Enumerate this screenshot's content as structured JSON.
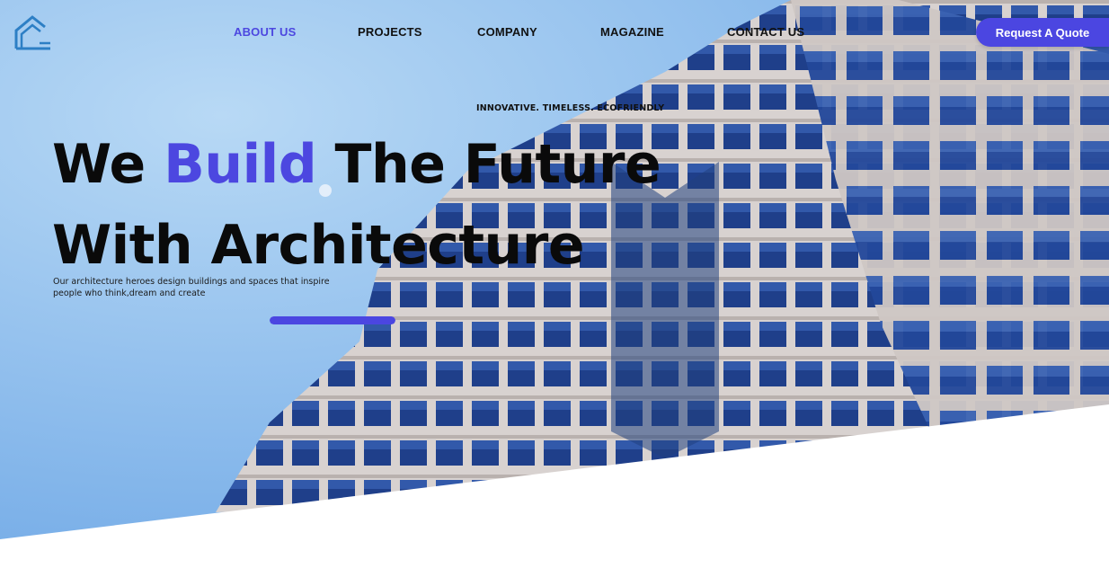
{
  "brand": {
    "logo_icon": "house-outline-icon",
    "accent_color": "#4c47e0"
  },
  "nav": {
    "items": [
      {
        "label": "ABOUT US",
        "active": true
      },
      {
        "label": "PROJECTS",
        "active": false
      },
      {
        "label": "COMPANY",
        "active": false
      },
      {
        "label": "MAGAZINE",
        "active": false
      },
      {
        "label": "CONTACT US",
        "active": false
      }
    ]
  },
  "cta": {
    "label": "Request A Quote",
    "color": "#4b46e1"
  },
  "hero": {
    "tagline": "INNOVATIVE. TIMELESS. ECOFRIENDLY",
    "headline_part1": "We ",
    "headline_accent": "Build",
    "headline_part2": " The Future",
    "headline_line2": "With Architecture",
    "subtitle": "Our architecture heroes design buildings and spaces that inspire people who think,dream and create",
    "progress_fraction": 1.0
  }
}
